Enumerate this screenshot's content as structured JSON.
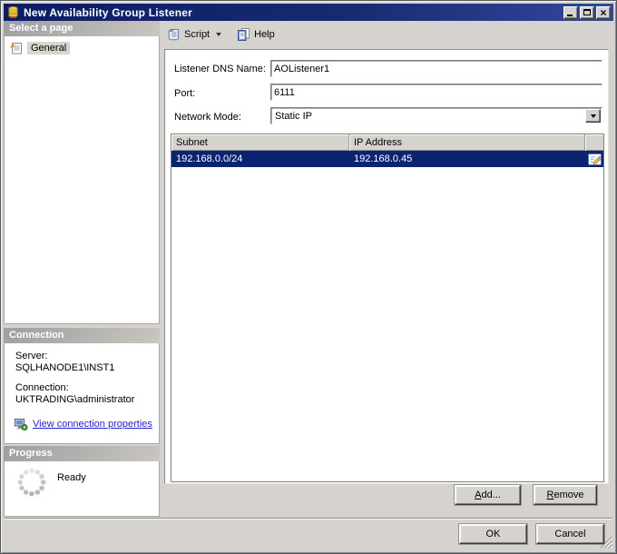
{
  "window": {
    "title": "New Availability Group Listener"
  },
  "toolbar": {
    "script_label": "Script",
    "help_label": "Help"
  },
  "sidebar": {
    "page_header": "Select a page",
    "pages": [
      {
        "label": "General",
        "selected": true
      }
    ],
    "connection_header": "Connection",
    "connection": {
      "server_label": "Server:",
      "server_value": "SQLHANODE1\\INST1",
      "connection_label": "Connection:",
      "connection_value": "UKTRADING\\administrator",
      "link_label": "View connection properties"
    },
    "progress_header": "Progress",
    "progress_status": "Ready"
  },
  "form": {
    "dns_label": "Listener DNS Name:",
    "dns_value": "AOListener1",
    "port_label": "Port:",
    "port_value": "6111",
    "network_mode_label": "Network Mode:",
    "network_mode_value": "Static IP"
  },
  "table": {
    "columns": [
      "Subnet",
      "IP Address"
    ],
    "rows": [
      {
        "subnet": "192.168.0.0/24",
        "ip": "192.168.0.45",
        "selected": true
      }
    ]
  },
  "buttons": {
    "add": "Add...",
    "remove": "Remove",
    "ok": "OK",
    "cancel": "Cancel"
  },
  "colors": {
    "title_bar": "#0c1d66",
    "selection": "#0a2472",
    "dialog_background": "#d6d3ce",
    "link": "#2323cb"
  }
}
